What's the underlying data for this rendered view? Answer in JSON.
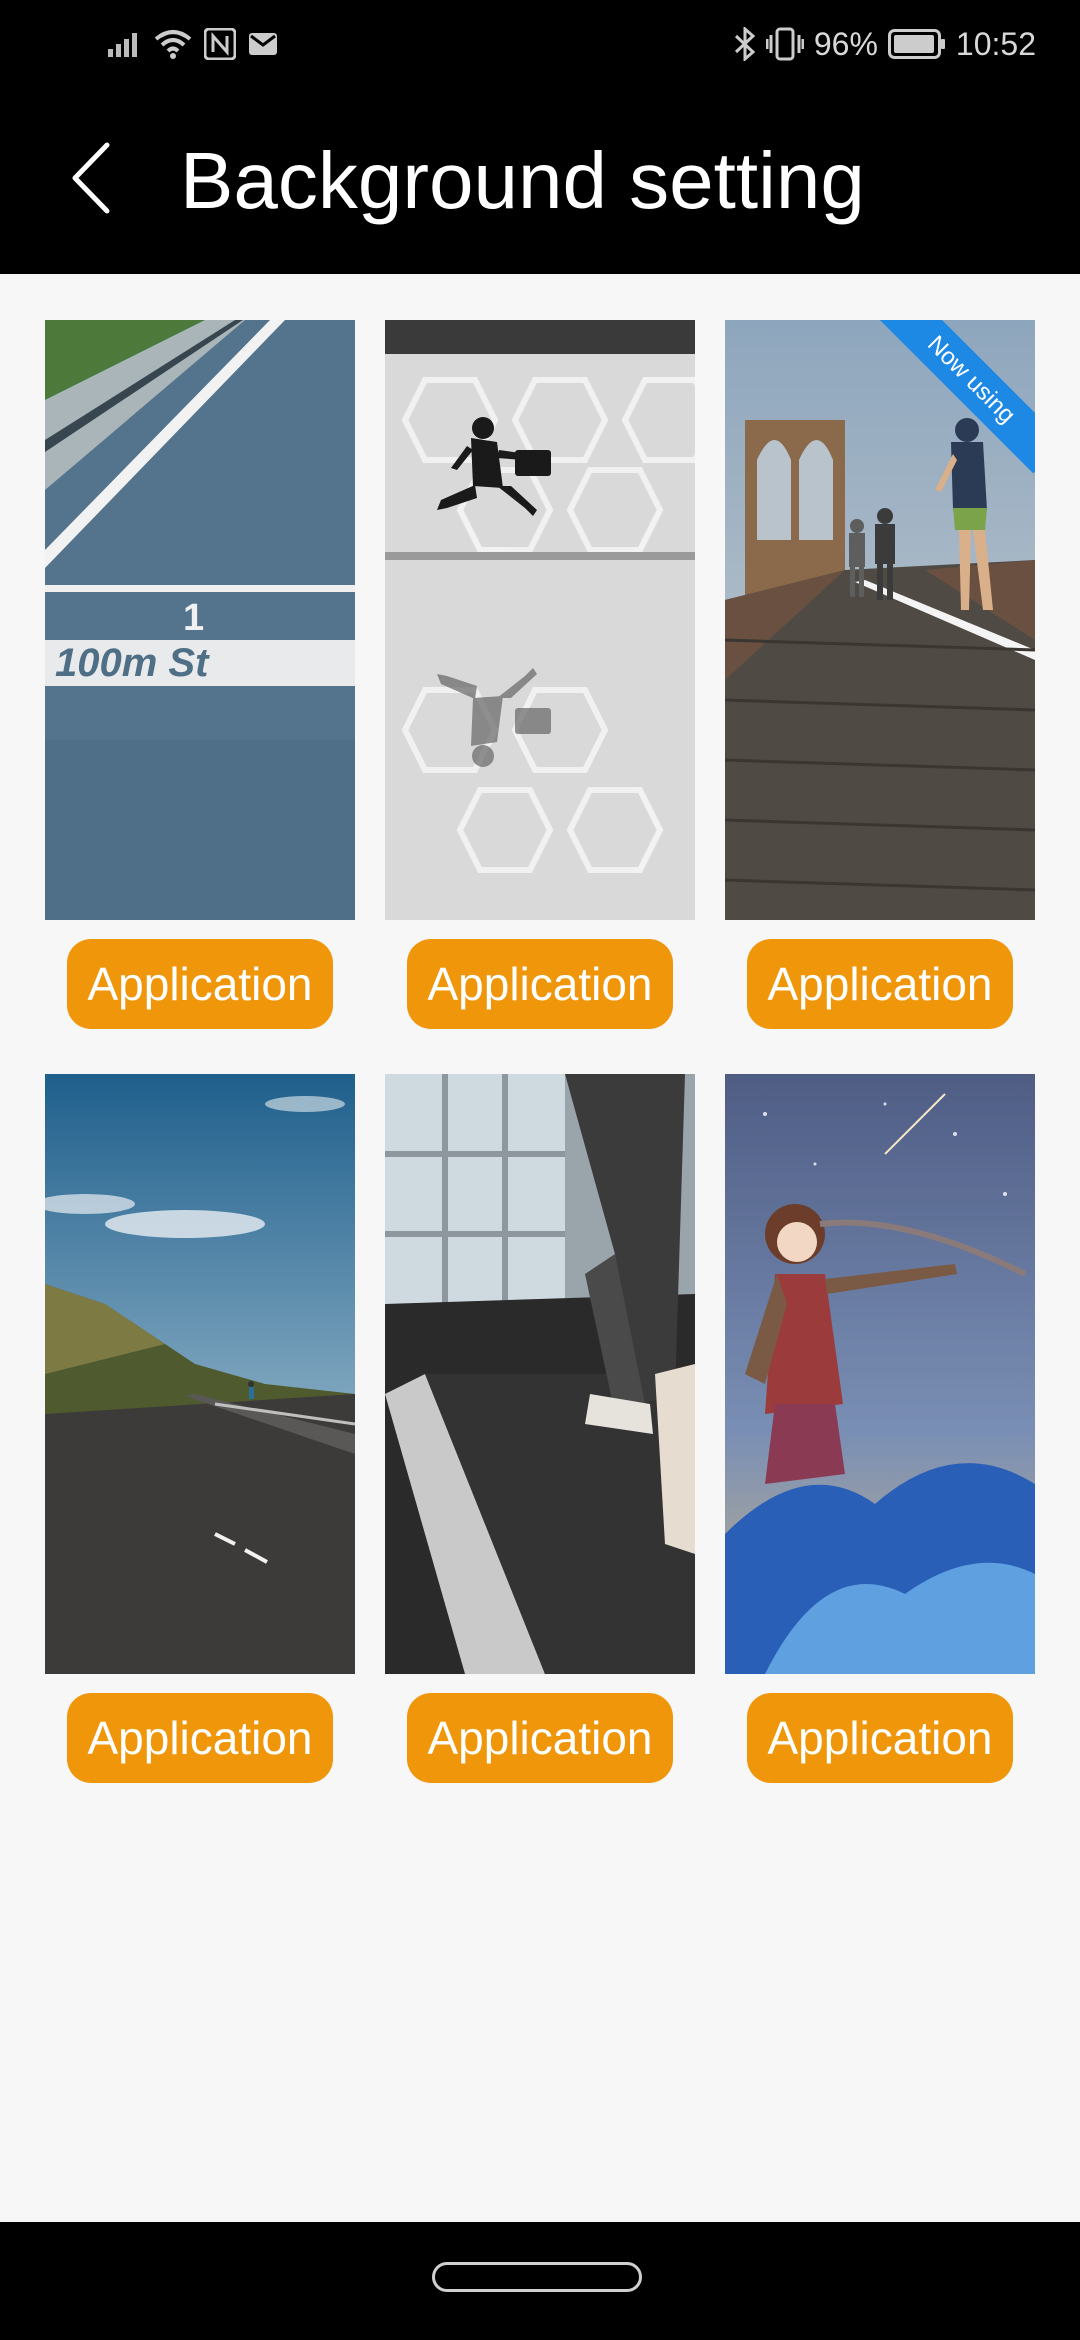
{
  "status_bar": {
    "icons_left": [
      "signal-icon",
      "wifi-icon",
      "nfc-icon",
      "mail-icon"
    ],
    "icons_right": [
      "bluetooth-icon",
      "vibrate-icon",
      "battery-icon"
    ],
    "battery": "96%",
    "time": "10:52"
  },
  "header": {
    "back_icon": "chevron-left-icon",
    "title": "Background setting"
  },
  "backgrounds": [
    {
      "image": "running track",
      "button_label": "Application"
    },
    {
      "image": "man leaping in glass hall",
      "button_label": "Application"
    },
    {
      "image": "runner on bridge",
      "button_label": "Application",
      "badge": "Now using"
    },
    {
      "image": "road by the coast",
      "button_label": "Application"
    },
    {
      "image": "treadmill",
      "button_label": "Application"
    },
    {
      "image": "anime girl in field",
      "button_label": "Application"
    }
  ],
  "colors": {
    "accent": "#f0960a",
    "badge": "#1e88e5",
    "app_bar": "#000000",
    "page": "#f7f7f7"
  },
  "nav_bar": {
    "home_icon": "home-pill-icon"
  }
}
